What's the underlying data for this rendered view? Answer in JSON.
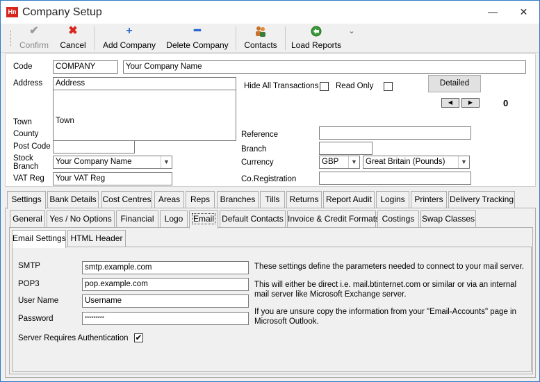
{
  "window": {
    "title": "Company Setup",
    "app_icon_text": "Hn",
    "minimize_glyph": "—",
    "close_glyph": "✕"
  },
  "toolbar": {
    "confirm": "Confirm",
    "cancel": "Cancel",
    "add_company": "Add Company",
    "delete_company": "Delete Company",
    "contacts": "Contacts",
    "load_reports": "Load Reports"
  },
  "form": {
    "code_label": "Code",
    "code_value": "COMPANY",
    "name_value": "Your Company Name",
    "address_label": "Address",
    "address_lines": [
      "Address",
      "",
      "",
      "Town"
    ],
    "town_label": "Town",
    "county_label": "County",
    "county_value": "",
    "postcode_label": "Post Code",
    "postcode_value": "",
    "stock_branch_label": "Stock Branch",
    "stock_branch_value": "Your Company Name",
    "vat_label": "VAT Reg",
    "vat_value": "Your VAT Reg",
    "hide_all_label": "Hide All Transactions",
    "read_only_label": "Read Only",
    "detailed_button": "Detailed",
    "counter": "0",
    "reference_label": "Reference",
    "reference_value": "",
    "branch_label": "Branch",
    "branch_value": "",
    "currency_label": "Currency",
    "currency_code": "GBP",
    "currency_name": "Great Britain (Pounds)",
    "coreg_label": "Co.Registration",
    "coreg_value": ""
  },
  "tabs_row1": [
    "Settings",
    "Bank Details",
    "Cost Centres",
    "Areas",
    "Reps",
    "Branches",
    "Tills",
    "Returns",
    "Report Audit",
    "Logins",
    "Printers",
    "Delivery Tracking"
  ],
  "tabs_row2": [
    "General",
    "Yes / No Options",
    "Financial",
    "Logo",
    "Email",
    "Default Contacts",
    "Invoice & Credit Formats",
    "Costings",
    "Swap Classes"
  ],
  "tabs_row3": [
    "Email Settings",
    "HTML Header"
  ],
  "email": {
    "smtp_label": "SMTP",
    "smtp_value": "smtp.example.com",
    "pop3_label": "POP3",
    "pop3_value": "pop.example.com",
    "username_label": "User Name",
    "username_value": "Username",
    "password_label": "Password",
    "password_value": "*********",
    "auth_label": "Server Requires Authentication",
    "auth_checked": "✔",
    "note1": "These settings define the parameters needed to connect to your mail server.",
    "note2": "This will either be direct i.e. mail.btinternet.com or similar or via an internal mail server like Microsoft Exchange server.",
    "note3": "If you are unsure copy the information from your \"Email-Accounts\" page in Microsoft Outlook."
  },
  "colors": {
    "accent": "#2b78c4",
    "cancel_red": "#d9261c",
    "add_blue": "#2a6ad2",
    "reports_green": "#3a9a3a"
  }
}
